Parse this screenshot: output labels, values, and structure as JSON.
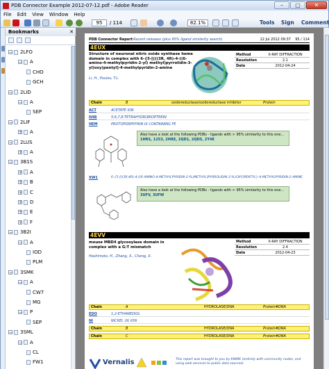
{
  "window": {
    "title": "PDB Connector Example 2012-07-12.pdf - Adobe Reader"
  },
  "menu": [
    "File",
    "Edit",
    "View",
    "Window",
    "Help"
  ],
  "toolbar": {
    "page_current": "95",
    "page_total": "/ 114",
    "zoom": "82.1%",
    "tools": "Tools",
    "sign": "Sign",
    "comment": "Comment"
  },
  "bookmarks": {
    "title": "Bookmarks",
    "items": [
      {
        "label": "2LFO",
        "level": 1,
        "expanded": true
      },
      {
        "label": "A",
        "level": 2,
        "expanded": true
      },
      {
        "label": "CHO",
        "level": 3
      },
      {
        "label": "GCH",
        "level": 3
      },
      {
        "label": "2LID",
        "level": 1,
        "expanded": true
      },
      {
        "label": "A",
        "level": 2,
        "expanded": true
      },
      {
        "label": "SEP",
        "level": 3
      },
      {
        "label": "2LIF",
        "level": 1,
        "expanded": true
      },
      {
        "label": "A",
        "level": 2,
        "expanded": false
      },
      {
        "label": "2LUS",
        "level": 1,
        "expanded": true
      },
      {
        "label": "A",
        "level": 2,
        "expanded": false
      },
      {
        "label": "3B1S",
        "level": 1,
        "expanded": true
      },
      {
        "label": "A",
        "level": 2,
        "expanded": false
      },
      {
        "label": "B",
        "level": 2,
        "expanded": false
      },
      {
        "label": "C",
        "level": 2,
        "expanded": false
      },
      {
        "label": "D",
        "level": 2,
        "expanded": false
      },
      {
        "label": "E",
        "level": 2,
        "expanded": false
      },
      {
        "label": "F",
        "level": 2,
        "expanded": false
      },
      {
        "label": "3B2I",
        "level": 1,
        "expanded": true
      },
      {
        "label": "A",
        "level": 2,
        "expanded": true
      },
      {
        "label": "IOD",
        "level": 3
      },
      {
        "label": "PLM",
        "level": 3
      },
      {
        "label": "3SMK",
        "level": 1,
        "expanded": true
      },
      {
        "label": "A",
        "level": 2,
        "expanded": true
      },
      {
        "label": "CW7",
        "level": 3
      },
      {
        "label": "MG",
        "level": 3
      },
      {
        "label": "P",
        "level": 2,
        "expanded": true
      },
      {
        "label": "SEP",
        "level": 3
      },
      {
        "label": "3SML",
        "level": 1,
        "expanded": true
      },
      {
        "label": "A",
        "level": 2,
        "expanded": true
      },
      {
        "label": "CL",
        "level": 3
      },
      {
        "label": "FW1",
        "level": 3
      }
    ]
  },
  "document": {
    "header_left": "PDB Connector Report",
    "header_mid": "Recent releases (plus 95% ligand similarity search)",
    "header_right": "12 Jul 2012 09:37",
    "header_page": "95 / 114",
    "entry1": {
      "id": "4EUX",
      "title": "Structure of neuronal nitric oxide synthase heme domain in complex with 6-{5-[(((3R, 4R)-4-((6-amino-4-methylpyridin-2-yl) methyl)pyrrolidin-3-yl)oxy)pentyl]-4-methylpyridin-2-amine",
      "authors": "Li, H., Poulos, T.L.",
      "meta": [
        {
          "k": "Method",
          "v": "X-RAY DIFFRACTION"
        },
        {
          "k": "Resolution",
          "v": "2.1"
        },
        {
          "k": "Date",
          "v": "2012-04-24"
        }
      ],
      "chain_row": {
        "chain": "Chain",
        "id": "B",
        "desc": "oxidoreductase/oxidoreductase inhibitor",
        "type": "Protein"
      },
      "ligands": [
        {
          "id": "ACT",
          "name": "ACETATE ION"
        },
        {
          "id": "H4B",
          "name": "5,6,7,8-TETRAHYDROBIOPTERIN"
        },
        {
          "id": "HEM",
          "name": "PROTOPORPHYRIN IX CONTAINING FE"
        }
      ],
      "similar1_intro": "Also have a look at the following PDBs - ligands with > 95% similarity to this one...",
      "similar1_ids": "1HRS, 1253, 2HRE, 2QD1, 2QD5, 2Y4E",
      "ligand4": {
        "id": "XW1",
        "name": "6-{5-[((3R,4R)-4-[(6-AMINO-4-METHYLPYRIDIN-2-YL)METHYL]PYRROLIDIN-3-YL)OXY]PENTYL}-4-METHYLPYRIDIN-2-AMINE"
      },
      "similar2_intro": "Also have a look at the following PDBs - ligands with > 95% similarity to this one...",
      "similar2_ids": "3UFV, 3UFW"
    },
    "entry2": {
      "id": "4EVV",
      "title": "mouse MBD4 glycosylase domain in complex with a G:T mismatch",
      "authors": "Hashimoto, H., Zhang, X., Cheng, X.",
      "meta": [
        {
          "k": "Method",
          "v": "X-RAY DIFFRACTION"
        },
        {
          "k": "Resolution",
          "v": "2.4"
        },
        {
          "k": "Date",
          "v": "2012-04-23"
        }
      ],
      "chain_row1": {
        "chain": "Chain",
        "id": "A",
        "desc": "HYDROLASE/DNA",
        "type": "Protein#DNA"
      },
      "ligands": [
        {
          "id": "EDO",
          "name": "1,2-ETHANEDIOL"
        },
        {
          "id": "NI",
          "name": "NICKEL (II) ION"
        }
      ],
      "chain_row2": {
        "chain": "Chain",
        "id": "B",
        "desc": "HYDROLASE/DNA",
        "type": "Protein#DNA"
      },
      "chain_row3": {
        "chain": "Chain",
        "id": "C",
        "desc": "HYDROLASE/DNA",
        "type": "Protein#DNA"
      }
    },
    "footer_logo": "Vernalis",
    "footer_note": "This report was brought to you by KNIME (entirely with community nodes, and using web services to public data sources)"
  }
}
